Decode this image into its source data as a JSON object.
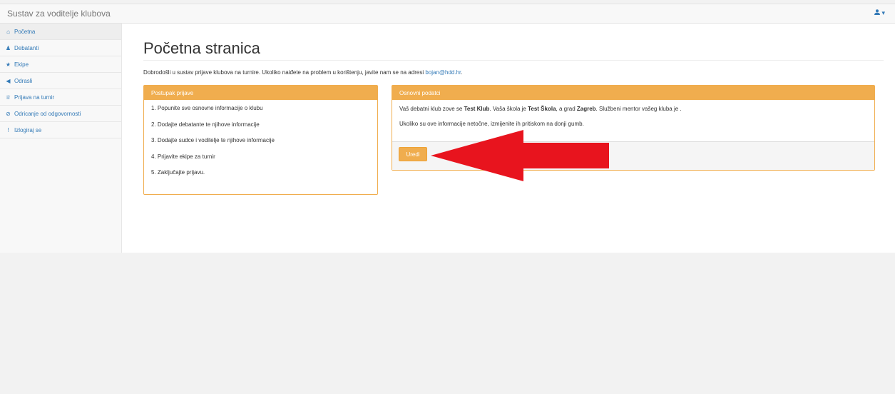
{
  "navbar": {
    "brand": "Sustav za voditelje klubova",
    "user_icon": "user-icon",
    "caret": "▾"
  },
  "sidebar": {
    "items": [
      {
        "icon": "home-icon",
        "glyph": "⌂",
        "label": "Početna",
        "active": true
      },
      {
        "icon": "user-icon",
        "glyph": "♟",
        "label": "Debatanti",
        "active": false
      },
      {
        "icon": "star-icon",
        "glyph": "★",
        "label": "Ekipe",
        "active": false
      },
      {
        "icon": "bullhorn-icon",
        "glyph": "◀",
        "label": "Odrasli",
        "active": false
      },
      {
        "icon": "trophy-icon",
        "glyph": "♕",
        "label": "Prijava na turnir",
        "active": false
      },
      {
        "icon": "ban-icon",
        "glyph": "⊘",
        "label": "Odricanje od odgovornosti",
        "active": false
      },
      {
        "icon": "exclamation-icon",
        "glyph": "!",
        "label": "Izlogiraj se",
        "active": false
      }
    ]
  },
  "main": {
    "title": "Početna stranica",
    "welcome_text": "Dobrodošli u sustav prijave klubova na turnire. Ukoliko naiđete na problem u korištenju, javite nam se na adresi ",
    "welcome_email": "bojan@hdd.hr",
    "welcome_end": "."
  },
  "panel_left": {
    "heading": "Postupak prijave",
    "steps": [
      "1. Popunite sve osnovne informacije o klubu",
      "2. Dodajte debatante te njihove informacije",
      "3. Dodajte sudce i voditelje te njihove informacije",
      "4. Prijavite ekipe za turnir",
      "5. Zaključajte prijavu."
    ]
  },
  "panel_right": {
    "heading": "Osnovni podatci",
    "line1_a": "Vaš debatni klub zove se ",
    "club": "Test Klub",
    "line1_b": ". Vaša škola je ",
    "school": "Test Škola",
    "line1_c": ", a grad ",
    "city": "Zagreb",
    "line1_d": ". Službeni mentor vašeg kluba je .",
    "line2": "Ukoliko su ove informacije netočne, izmijenite ih pritiskom na donji gumb.",
    "button": "Uredi"
  },
  "colors": {
    "accent": "#f0ad4e",
    "link": "#337ab7",
    "arrow": "#e8141e"
  }
}
